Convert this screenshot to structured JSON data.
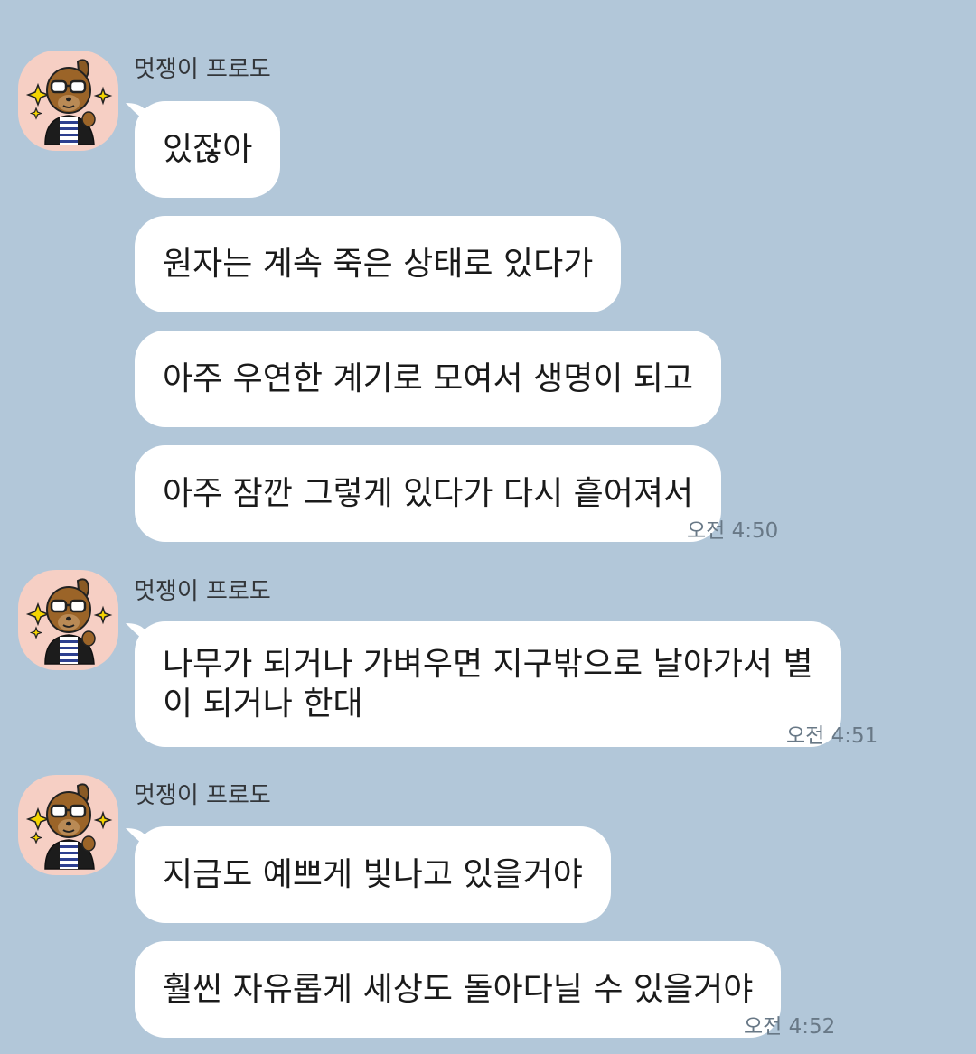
{
  "chat": {
    "groups": [
      {
        "sender": "멋쟁이 프로도",
        "avatar_icon": "frodo-dog-sunglasses-icon",
        "messages": [
          "있잖아",
          "원자는 계속 죽은 상태로 있다가",
          "아주 우연한 계기로 모여서 생명이 되고",
          "아주 잠깐 그렇게 있다가 다시 흩어져서"
        ],
        "time": "오전 4:50"
      },
      {
        "sender": "멋쟁이 프로도",
        "avatar_icon": "frodo-dog-sunglasses-icon",
        "messages": [
          "나무가 되거나 가벼우면 지구밖으로 날아가서 별\n이 되거나 한대"
        ],
        "time": "오전 4:51"
      },
      {
        "sender": "멋쟁이 프로도",
        "avatar_icon": "frodo-dog-sunglasses-icon",
        "messages": [
          "지금도 예쁘게 빛나고 있을거야",
          "훨씬 자유롭게 세상도 돌아다닐 수 있을거야"
        ],
        "time": "오전 4:52"
      }
    ]
  },
  "colors": {
    "background": "#b2c7d9",
    "bubble": "#ffffff",
    "avatar_bg": "#f6cfc4",
    "time_text": "#687886"
  }
}
